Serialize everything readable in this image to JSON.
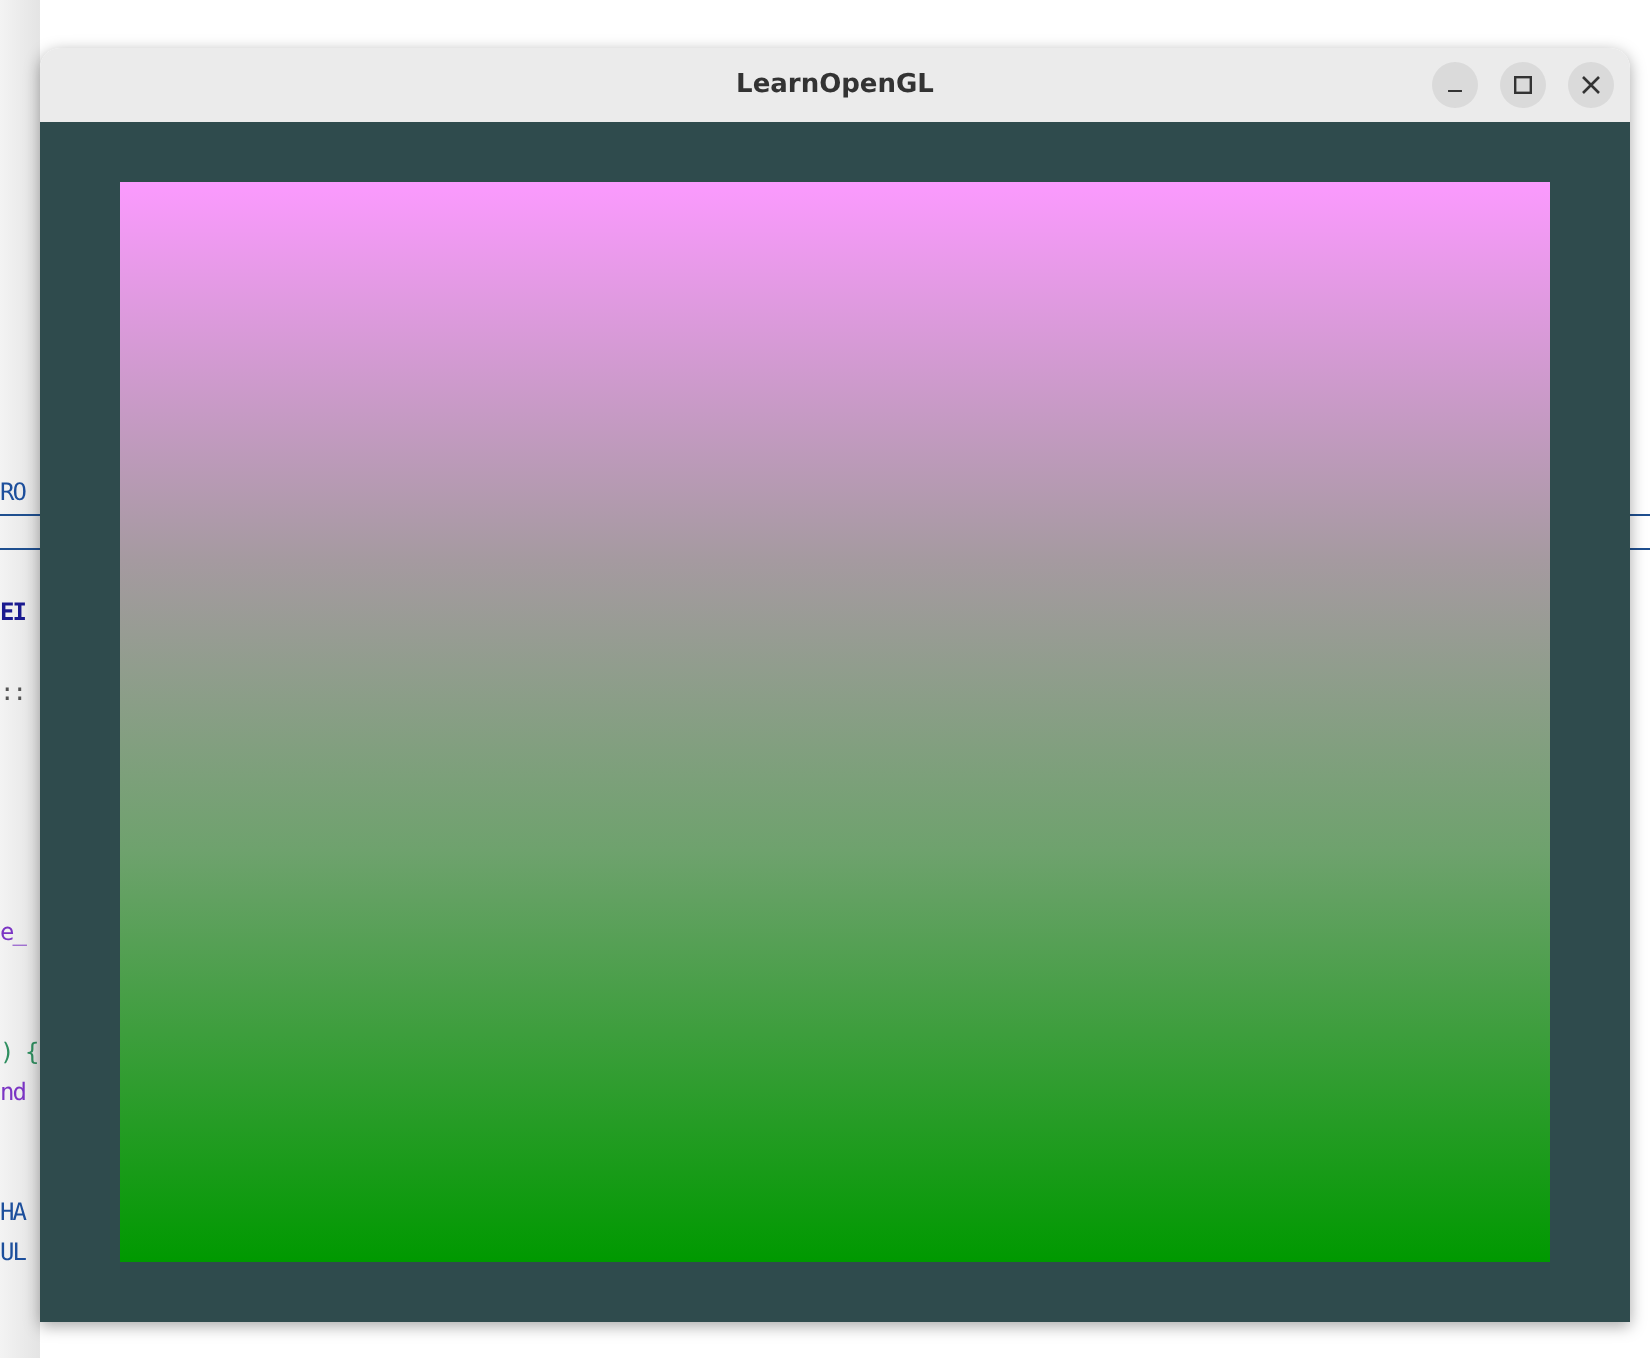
{
  "background_editor": {
    "fragments": [
      {
        "text": "RO",
        "kind": "macro"
      },
      {
        "text": "EI",
        "kind": "keyword"
      },
      {
        "text": "::",
        "kind": "operator"
      },
      {
        "text": "e_",
        "kind": "function"
      },
      {
        "text": ") {",
        "kind": "brace"
      },
      {
        "text": "nd",
        "kind": "function"
      },
      {
        "text": "HA",
        "kind": "macro"
      },
      {
        "text": "UL",
        "kind": "macro"
      }
    ]
  },
  "window": {
    "title": "LearnOpenGL",
    "controls": [
      {
        "kind": "minimize"
      },
      {
        "kind": "maximize"
      },
      {
        "kind": "close"
      }
    ]
  }
}
